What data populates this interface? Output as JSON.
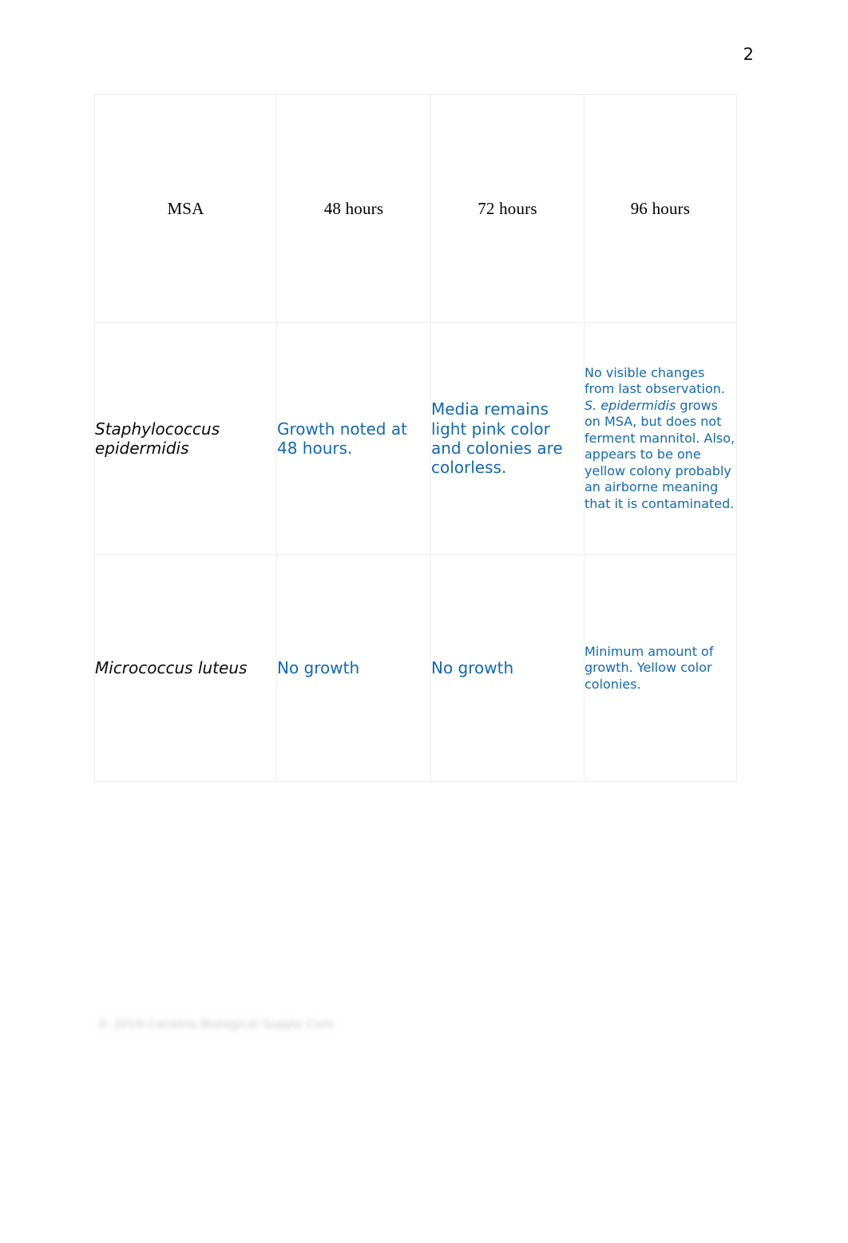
{
  "page": {
    "number": "2",
    "footer_note": "© 2019 Carolina Biological Supply Company"
  },
  "colors": {
    "observation_text": "#1268b3",
    "header_text": "#000000",
    "table_border": "#ededed"
  },
  "table": {
    "headers": [
      "MSA",
      "48 hours",
      "72 hours",
      "96 hours"
    ],
    "rows": [
      {
        "organism": "Staphylococcus epidermidis",
        "h48": "Growth noted at 48 hours.",
        "h72": "Media remains light pink color and colonies are colorless.",
        "h96_part1": "No visible changes from last observation. ",
        "h96_italic": "S. epidermidis",
        "h96_part2": " grows on MSA, but does not ferment mannitol. Also, appears to be one yellow colony probably an airborne meaning that it is contaminated."
      },
      {
        "organism": "Micrococcus luteus",
        "h48": "No growth",
        "h72": "No growth",
        "h96": "Minimum amount of growth.  Yellow color colonies."
      }
    ]
  }
}
